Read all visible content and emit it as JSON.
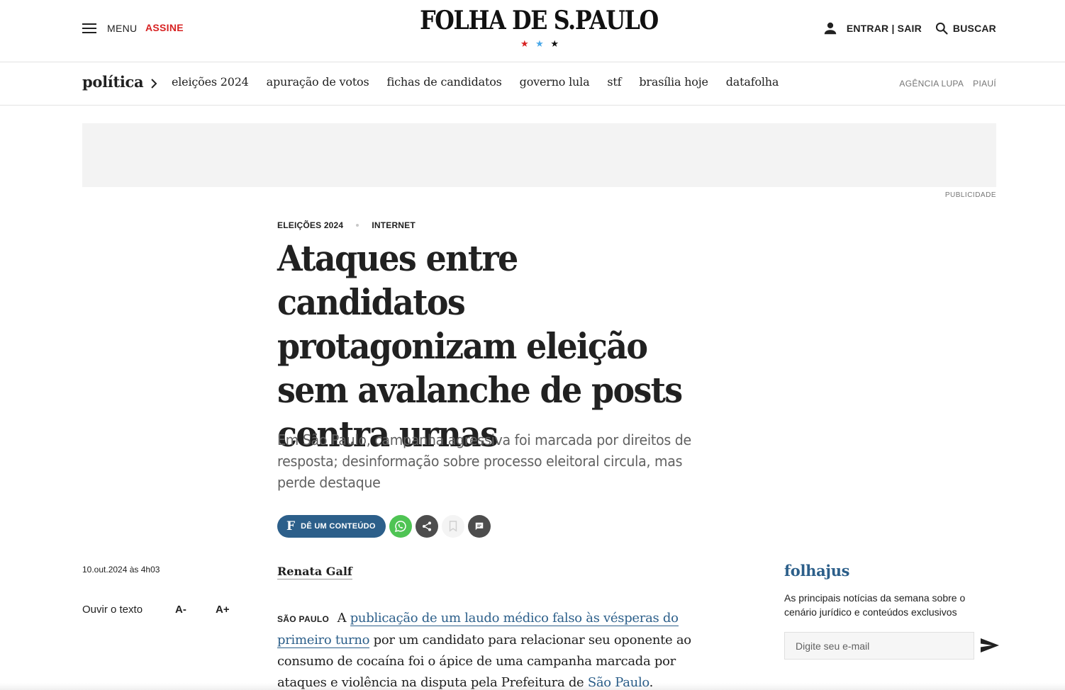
{
  "header": {
    "menu_label": "MENU",
    "subscribe_label": "ASSINE",
    "logo_text": "FOLHA DE S.PAULO",
    "login_label": "ENTRAR | SAIR",
    "search_label": "BUSCAR",
    "star_colors": [
      "#d72222",
      "#4aa8e8",
      "#111111"
    ]
  },
  "section_nav": {
    "title": "política",
    "items": [
      "eleições 2024",
      "apuração de votos",
      "fichas de candidatos",
      "governo lula",
      "stf",
      "brasília hoje",
      "datafolha"
    ],
    "right_links": [
      "AGÊNCIA LUPA",
      "PIAUÍ"
    ]
  },
  "ad": {
    "label": "PUBLICIDADE"
  },
  "article": {
    "kicker": [
      "ELEIÇÕES 2024",
      "INTERNET"
    ],
    "headline": "Ataques entre candidatos protagonizam eleição sem avalanche de posts contra urnas",
    "subtitle": "Em São Paulo, campanha agressiva foi marcada por direitos de resposta; desinformação sobre processo eleitoral circula, mas perde destaque",
    "gift_button": {
      "letter": "F",
      "label": "DÊ UM CONTEÚDO"
    },
    "date": "10.out.2024 às 4h03",
    "listen_label": "Ouvir o texto",
    "font_decrease": "A-",
    "font_increase": "A+",
    "author": "Renata Galf",
    "dateline": "SÃO PAULO",
    "body_parts": {
      "p1": "A",
      "link1": "publicação de um laudo médico falso às vésperas do primeiro turno",
      "p2": "por um candidato para relacionar seu oponente ao consumo de cocaína foi o ápice de uma campanha marcada por ataques e violência na disputa pela Prefeitura de",
      "link2": "São Paulo",
      "p3": "."
    },
    "accent_color": "#2c5f8a"
  },
  "newsletter": {
    "title": "folhajus",
    "description": "As principais notícias da semana sobre o cenário jurídico e conteúdos exclusivos",
    "input_placeholder": "Digite seu e-mail"
  }
}
